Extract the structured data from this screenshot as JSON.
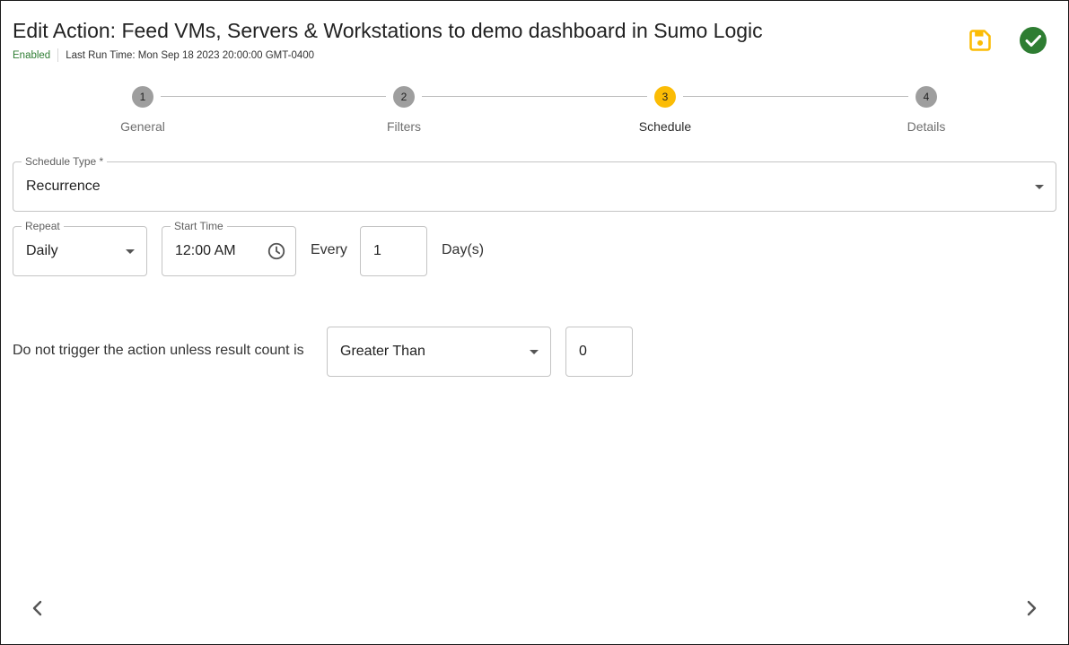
{
  "header": {
    "title": "Edit Action: Feed VMs, Servers & Workstations to demo dashboard in Sumo Logic",
    "status": "Enabled",
    "last_run": "Last Run Time: Mon Sep 18 2023 20:00:00 GMT-0400"
  },
  "toolbar": {
    "save_icon": "floppy-disk-icon",
    "confirm_icon": "check-circle-icon"
  },
  "stepper": {
    "active_step": 3,
    "steps": [
      {
        "number": "1",
        "label": "General"
      },
      {
        "number": "2",
        "label": "Filters"
      },
      {
        "number": "3",
        "label": "Schedule"
      },
      {
        "number": "4",
        "label": "Details"
      }
    ]
  },
  "schedule": {
    "type_label": "Schedule Type *",
    "type_value": "Recurrence",
    "repeat_label": "Repeat",
    "repeat_value": "Daily",
    "start_time_label": "Start Time",
    "start_time_value": "12:00 AM",
    "every_text": "Every",
    "every_value": "1",
    "unit_text": "Day(s)"
  },
  "trigger": {
    "text": "Do not trigger the action unless result count is",
    "operator_value": "Greater Than",
    "count_value": "0"
  },
  "colors": {
    "accent": "#fbbc05",
    "enabled_green": "#2e7d32",
    "confirm_green": "#2e7d32",
    "step_inactive": "#9e9e9e"
  }
}
